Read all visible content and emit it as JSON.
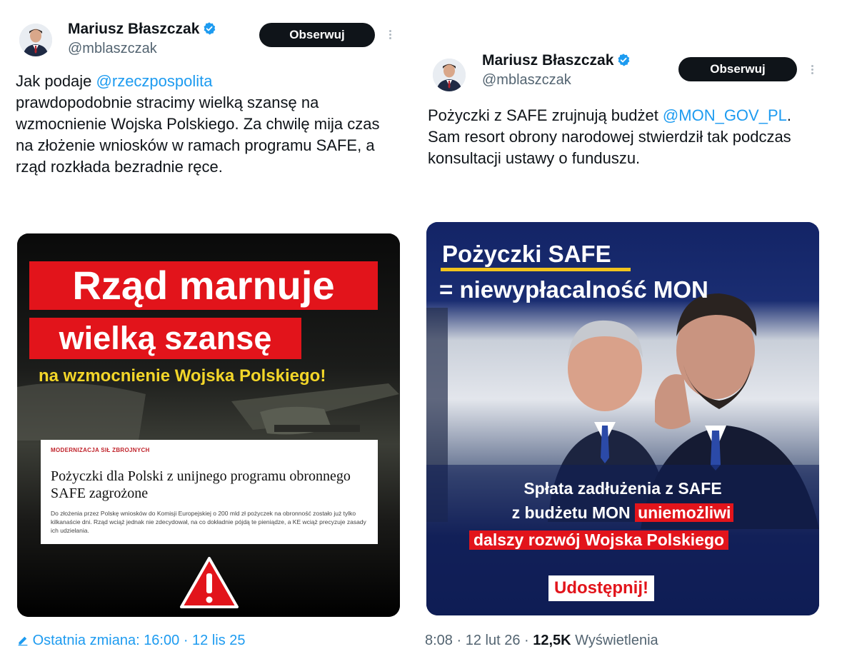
{
  "tweet_left": {
    "author_name": "Mariusz Błaszczak",
    "handle": "@mblaszczak",
    "follow_label": "Obserwuj",
    "text_mention": "@rzeczpospolita",
    "text_lead": "Jak podaje ",
    "text_body": "prawdopodobnie stracimy wielką szansę na wzmocnienie Wojska Polskiego. Za chwilę mija czas na złożenie wniosków w ramach programu SAFE, a rząd rozkłada bezradnie ręce.",
    "media": {
      "headline_line1": "Rząd marnuje",
      "headline_line2": "wielką szansę",
      "subheadline": "na wzmocnienie Wojska Polskiego!",
      "article_kicker": "MODERNIZACJA SIŁ ZBROJNYCH",
      "article_headline": "Pożyczki dla Polski z unijnego programu obronnego SAFE zagrożone",
      "article_lead": "Do złożenia przez Polskę wniosków do Komisji Europejskiej o 200 mld zł pożyczek na obronność zostało już tylko kilkanaście dni. Rząd wciąż jednak nie zdecydował, na co dokładnie pójdą te pieniądze, a KE wciąż precyzuje zasady ich udzielania."
    },
    "footer_edit_label": "Ostatnia zmiana: 16:00",
    "footer_date": "· 12 lis 25"
  },
  "tweet_right": {
    "author_name": "Mariusz Błaszczak",
    "handle": "@mblaszczak",
    "follow_label": "Obserwuj",
    "text_lead": "Pożyczki z SAFE zrujnują budżet ",
    "text_mention": "@MON_GOV_PL",
    "text_body": ". Sam resort obrony narodowej stwierdził tak podczas konsultacji ustawy o funduszu.",
    "media": {
      "title_line1": "Pożyczki SAFE",
      "title_line2": "= niewypłacalność MON",
      "caption_line1": "Spłata zadłużenia z SAFE",
      "caption_line2_white": "z budżetu MON ",
      "caption_line2_red": "uniemożliwi",
      "caption_line3": "dalszy rozwój Wojska Polskiego",
      "share_label": "Udostępnij!"
    },
    "footer_time": "8:08",
    "footer_date": " · 12 lut 26 · ",
    "footer_views_count": "12,5K",
    "footer_views_label": " Wyświetlenia"
  },
  "colors": {
    "accent_blue": "#1d9bf0",
    "alert_red": "#e2141b",
    "highlight_yellow": "#f3d629",
    "navy": "#10205a"
  },
  "icons": [
    "verified-badge-icon",
    "more-options-icon",
    "edit-pencil-icon",
    "warning-triangle-icon"
  ]
}
